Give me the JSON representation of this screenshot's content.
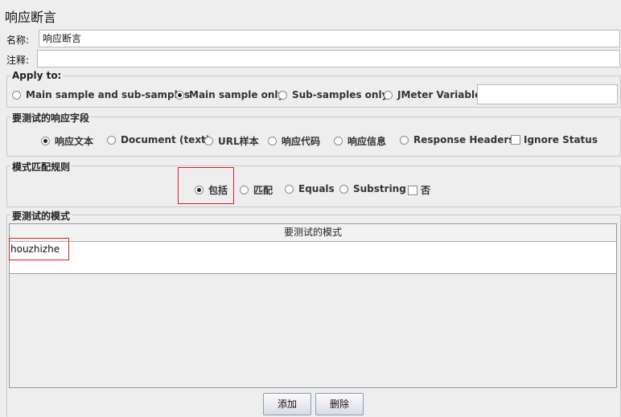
{
  "panel_title": "响应断言",
  "name_label": "名称:",
  "name_value": "响应断言",
  "comment_label": "注释:",
  "comment_value": "",
  "apply_to": {
    "legend": "Apply to:",
    "options": [
      "Main sample and sub-samples",
      "Main sample only",
      "Sub-samples only",
      "JMeter Variable"
    ],
    "selected": "Main sample only",
    "variable_value": ""
  },
  "response_field": {
    "legend": "要测试的响应字段",
    "options": [
      "响应文本",
      "Document (text)",
      "URL样本",
      "响应代码",
      "响应信息",
      "Response Headers"
    ],
    "selected": "响应文本",
    "ignore_status_label": "Ignore Status"
  },
  "pattern_rules": {
    "legend": "模式匹配规则",
    "options": [
      "包括",
      "匹配",
      "Equals",
      "Substring"
    ],
    "selected": "包括",
    "not_label": "否"
  },
  "patterns": {
    "legend": "要测试的模式",
    "column_header": "要测试的模式",
    "rows": [
      "houzhizhe"
    ]
  },
  "buttons": {
    "add": "添加",
    "delete": "删除"
  }
}
